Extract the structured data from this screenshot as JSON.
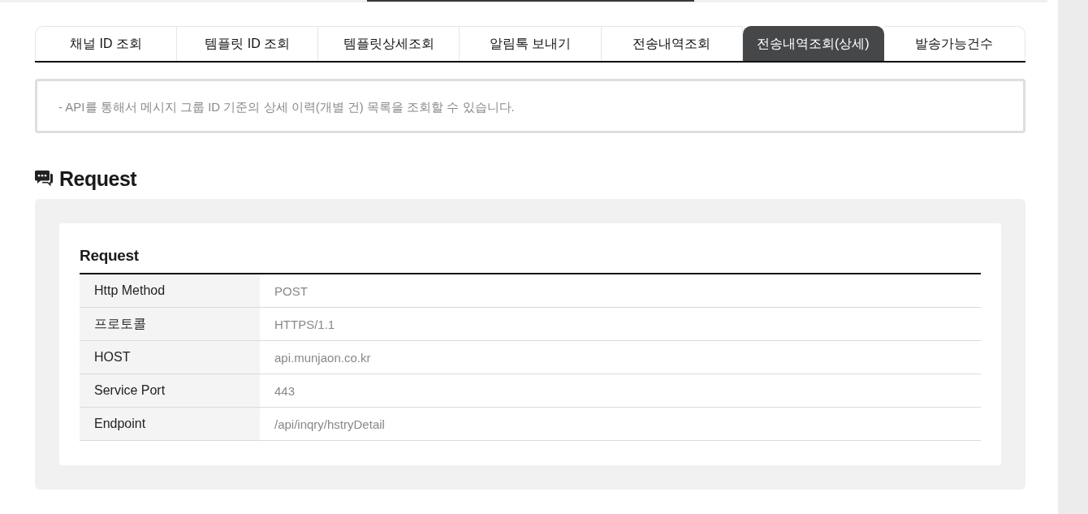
{
  "tabs": [
    {
      "label": "채널 ID 조회",
      "selected": false
    },
    {
      "label": "템플릿 ID 조회",
      "selected": false
    },
    {
      "label": "템플릿상세조회",
      "selected": false
    },
    {
      "label": "알림톡 보내기",
      "selected": false
    },
    {
      "label": "전송내역조회",
      "selected": false
    },
    {
      "label": "전송내역조회(상세)",
      "selected": true
    },
    {
      "label": "발송가능건수",
      "selected": false
    }
  ],
  "description": "- API를 통해서 메시지 그룹 ID 기준의 상세 이력(개별 건) 목록을 조회할 수 있습니다.",
  "section": {
    "title": "Request",
    "card": {
      "title": "Request",
      "rows": [
        {
          "label": "Http Method",
          "value": "POST"
        },
        {
          "label": "프로토콜",
          "value": "HTTPS/1.1"
        },
        {
          "label": "HOST",
          "value": "api.munjaon.co.kr"
        },
        {
          "label": "Service Port",
          "value": "443"
        },
        {
          "label": "Endpoint",
          "value": "/api/inqry/hstryDetail"
        }
      ]
    }
  }
}
